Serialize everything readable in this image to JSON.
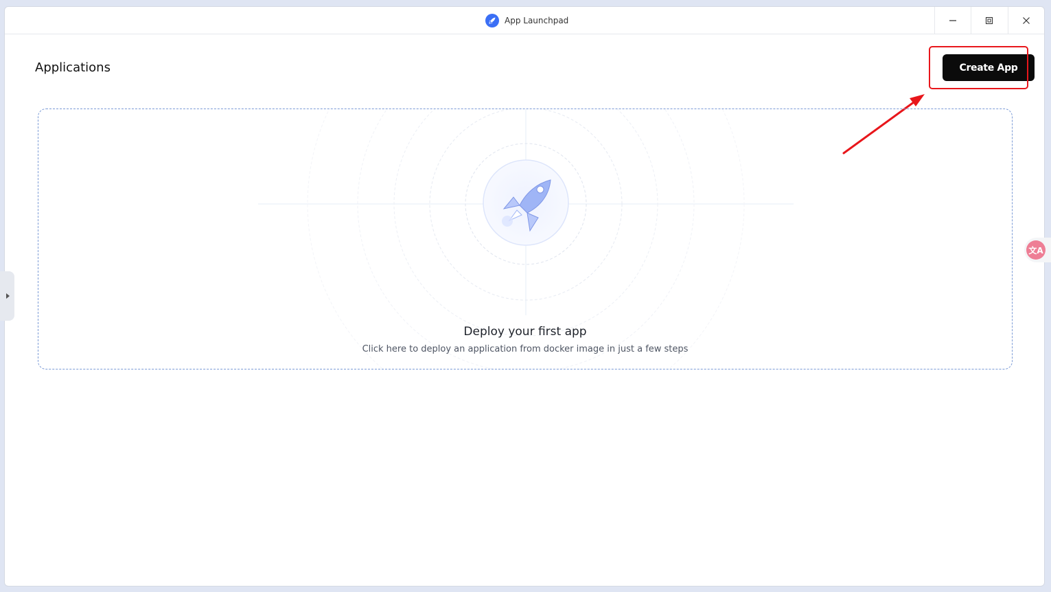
{
  "window": {
    "title": "App Launchpad",
    "controls": {
      "minimize_icon": "minimize-icon",
      "maximize_icon": "restore-icon",
      "close_icon": "close-icon"
    }
  },
  "header": {
    "title": "Applications",
    "create_button_label": "Create App"
  },
  "empty_state": {
    "title": "Deploy your first app",
    "subtitle": "Click here to deploy an application from docker image in just a few steps",
    "icon": "rocket-icon"
  },
  "annotation": {
    "highlight_color": "#e8161b"
  },
  "side_tab": {
    "icon": "caret-right-icon"
  },
  "translate_widget": {
    "icon": "translate-icon",
    "glyph": "文A"
  },
  "colors": {
    "accent": "#0b0b0b",
    "dashed_border": "#7a9ad6",
    "rocket": "#8aa6f0"
  }
}
